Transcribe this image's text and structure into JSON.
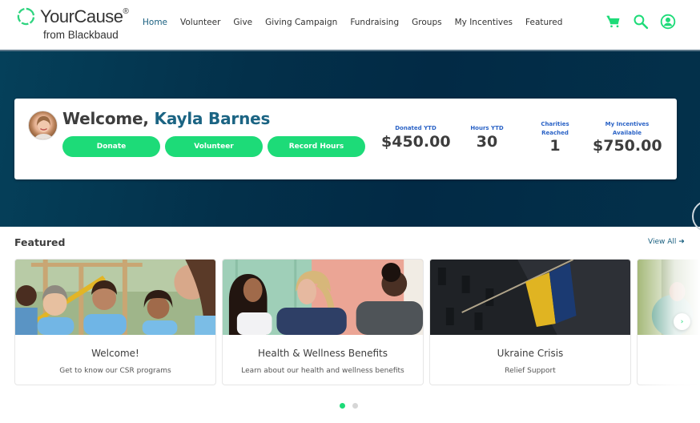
{
  "brand": {
    "name": "YourCause",
    "registered": "®",
    "tagline": "from Blackbaud",
    "accent": "#1ddb78",
    "primary_text": "#1a6080",
    "hero_bg": "#03304a"
  },
  "nav": {
    "items": [
      {
        "label": "Home",
        "active": true
      },
      {
        "label": "Volunteer",
        "active": false
      },
      {
        "label": "Give",
        "active": false
      },
      {
        "label": "Giving Campaign",
        "active": false
      },
      {
        "label": "Fundraising",
        "active": false
      },
      {
        "label": "Groups",
        "active": false
      },
      {
        "label": "My Incentives",
        "active": false
      },
      {
        "label": "Featured",
        "active": false
      }
    ],
    "icons": [
      "cart-icon",
      "search-icon",
      "user-account-icon"
    ]
  },
  "welcome": {
    "greeting": "Welcome, ",
    "user_name": "Kayla Barnes",
    "buttons": {
      "donate": "Donate",
      "volunteer": "Volunteer",
      "record_hours": "Record Hours"
    },
    "stats": [
      {
        "label": "Donated YTD",
        "value": "$450.00"
      },
      {
        "label": "Hours YTD",
        "value": "30"
      },
      {
        "label": "Charities Reached",
        "value": "1"
      },
      {
        "label": "My Incentives Available",
        "value": "$750.00"
      }
    ]
  },
  "featured": {
    "title": "Featured",
    "view_all": "View All",
    "cards": [
      {
        "title": "Welcome!",
        "subtitle": "Get to know our CSR programs",
        "image": "volunteers-smiling-photo"
      },
      {
        "title": "Health & Wellness Benefits",
        "subtitle": "Learn about our health and wellness benefits",
        "image": "three-women-laughing-photo"
      },
      {
        "title": "Ukraine Crisis",
        "subtitle": "Relief Support",
        "image": "ukraine-flag-photo"
      },
      {
        "title": "",
        "subtitle": "",
        "image": "person-in-forest-photo"
      }
    ],
    "next_label": "›",
    "pagination": {
      "current": 1,
      "total": 2
    }
  }
}
